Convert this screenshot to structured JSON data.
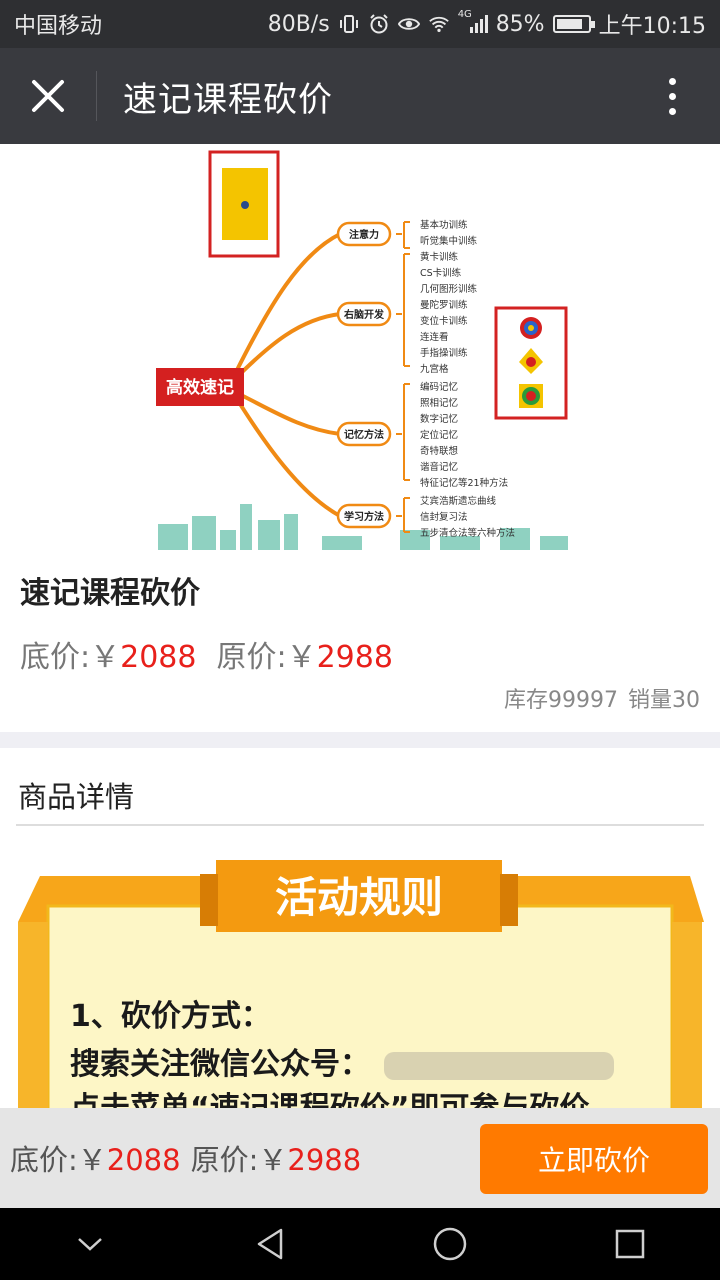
{
  "status_bar": {
    "carrier": "中国移动",
    "speed": "80B/s",
    "network": "4G",
    "battery": "85%",
    "battery_level": 0.85,
    "time": "上午10:15"
  },
  "header": {
    "title": "速记课程砍价"
  },
  "hero": {
    "center_label": "高效速记",
    "branches": [
      {
        "label": "注意力",
        "items": [
          "基本功训练",
          "听觉集中训练"
        ]
      },
      {
        "label": "右脑开发",
        "items": [
          "黄卡训练",
          "CS卡训练",
          "几何图形训练",
          "曼陀罗训练",
          "变位卡训练",
          "连连看",
          "手指操训练",
          "九宫格"
        ]
      },
      {
        "label": "记忆方法",
        "items": [
          "编码记忆",
          "照相记忆",
          "数字记忆",
          "定位记忆",
          "奇特联想",
          "谐音记忆",
          "特征记忆等21种方法"
        ]
      },
      {
        "label": "学习方法",
        "items": [
          "艾宾浩斯遗忘曲线",
          "信封复习法",
          "五步清仓法等六种方法"
        ]
      }
    ]
  },
  "product": {
    "title": "速记课程砍价",
    "floor_label": "底价:￥",
    "floor_value": "2088",
    "orig_label": "原价:￥",
    "orig_value": "2988",
    "stock": "库存99997",
    "sales": "销量30"
  },
  "details": {
    "title": "商品详情",
    "banner_title": "活动规则",
    "line1": "1、砍价方式：",
    "line2": "搜索关注微信公众号：",
    "line3": "点击菜单“速记课程砍价”即可参与砍价"
  },
  "bottom": {
    "floor_label": "底价:￥",
    "floor_value": "2088",
    "orig_label": "原价:￥",
    "orig_value": "2988",
    "button": "立即砍价"
  },
  "colors": {
    "accent": "#ff7a00",
    "price_red": "#e8201b",
    "header_bg": "#393a3f"
  }
}
